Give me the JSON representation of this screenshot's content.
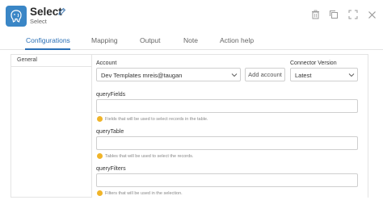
{
  "header": {
    "title": "Select",
    "subtitle": "Select",
    "brand_color": "#3a86c6"
  },
  "tabs": [
    {
      "label": "Configurations",
      "active": true
    },
    {
      "label": "Mapping",
      "active": false
    },
    {
      "label": "Output",
      "active": false
    },
    {
      "label": "Note",
      "active": false
    },
    {
      "label": "Action help",
      "active": false
    }
  ],
  "sidebar": {
    "items": [
      {
        "label": "General"
      }
    ]
  },
  "form": {
    "account": {
      "label": "Account",
      "value": "Dev Templates mreis@taugan",
      "add_label": "Add account"
    },
    "connector_version": {
      "label": "Connector Version",
      "value": "Latest"
    },
    "fields": [
      {
        "label": "queryFields",
        "value": "",
        "hint": "Fields that will be used to select records in the table."
      },
      {
        "label": "queryTable",
        "value": "",
        "hint": "Tables that will be used to select the records."
      },
      {
        "label": "queryFilters",
        "value": "",
        "hint": "Filters that will be used in the selection."
      }
    ]
  },
  "colors": {
    "accent": "#2b70b6",
    "hint_icon": "#f0b429"
  }
}
